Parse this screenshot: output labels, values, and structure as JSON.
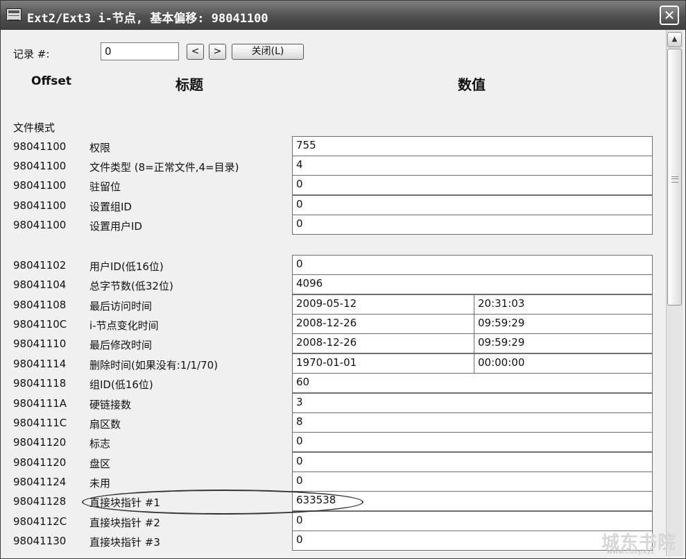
{
  "window": {
    "title": "Ext2/Ext3 i-节点, 基本偏移: 98041100",
    "close_icon": "close-icon",
    "app_icon": "disk-icon"
  },
  "record": {
    "label": "记录 #:",
    "value": "0",
    "prev_label": "<",
    "next_label": ">",
    "close_label": "关闭(L)"
  },
  "headers": {
    "offset": "Offset",
    "title": "标题",
    "value": "数值"
  },
  "section": {
    "file_mode": "文件模式"
  },
  "rows": [
    {
      "offset": "98041100",
      "title": "权限",
      "value": "755"
    },
    {
      "offset": "98041100",
      "title": "文件类型 (8=正常文件,4=目录)",
      "value": "4"
    },
    {
      "offset": "98041100",
      "title": "驻留位",
      "value": "0"
    },
    {
      "offset": "98041100",
      "title": "设置组ID",
      "value": "0"
    },
    {
      "offset": "98041100",
      "title": "设置用户ID",
      "value": "0"
    },
    {
      "offset": "98041102",
      "title": "用户ID(低16位)",
      "value": "0"
    },
    {
      "offset": "98041104",
      "title": "总字节数(低32位)",
      "value": "4096"
    },
    {
      "offset": "98041108",
      "title": "最后访问时间",
      "value": "2009-05-12",
      "value2": "20:31:03"
    },
    {
      "offset": "9804110C",
      "title": "i-节点变化时间",
      "value": "2008-12-26",
      "value2": "09:59:29"
    },
    {
      "offset": "98041110",
      "title": "最后修改时间",
      "value": "2008-12-26",
      "value2": "09:59:29"
    },
    {
      "offset": "98041114",
      "title": "删除时间(如果没有:1/1/70)",
      "value": "1970-01-01",
      "value2": "00:00:00"
    },
    {
      "offset": "98041118",
      "title": "组ID(低16位)",
      "value": "60"
    },
    {
      "offset": "9804111A",
      "title": "硬链接数",
      "value": "3"
    },
    {
      "offset": "9804111C",
      "title": "扇区数",
      "value": "8"
    },
    {
      "offset": "98041120",
      "title": "标志",
      "value": "0"
    },
    {
      "offset": "98041120",
      "title": "盘区",
      "value": "0"
    },
    {
      "offset": "98041124",
      "title": "未用",
      "value": "0"
    },
    {
      "offset": "98041128",
      "title": "直接块指针 #1",
      "value": "633538"
    },
    {
      "offset": "9804112C",
      "title": "直接块指针 #2",
      "value": "0"
    },
    {
      "offset": "98041130",
      "title": "直接块指针 #3",
      "value": "0"
    }
  ],
  "scrollbar": {
    "up_icon": "scroll-up-arrow-icon"
  },
  "watermark": {
    "text": "城东书院",
    "url": "www.cdsy.xyz"
  }
}
